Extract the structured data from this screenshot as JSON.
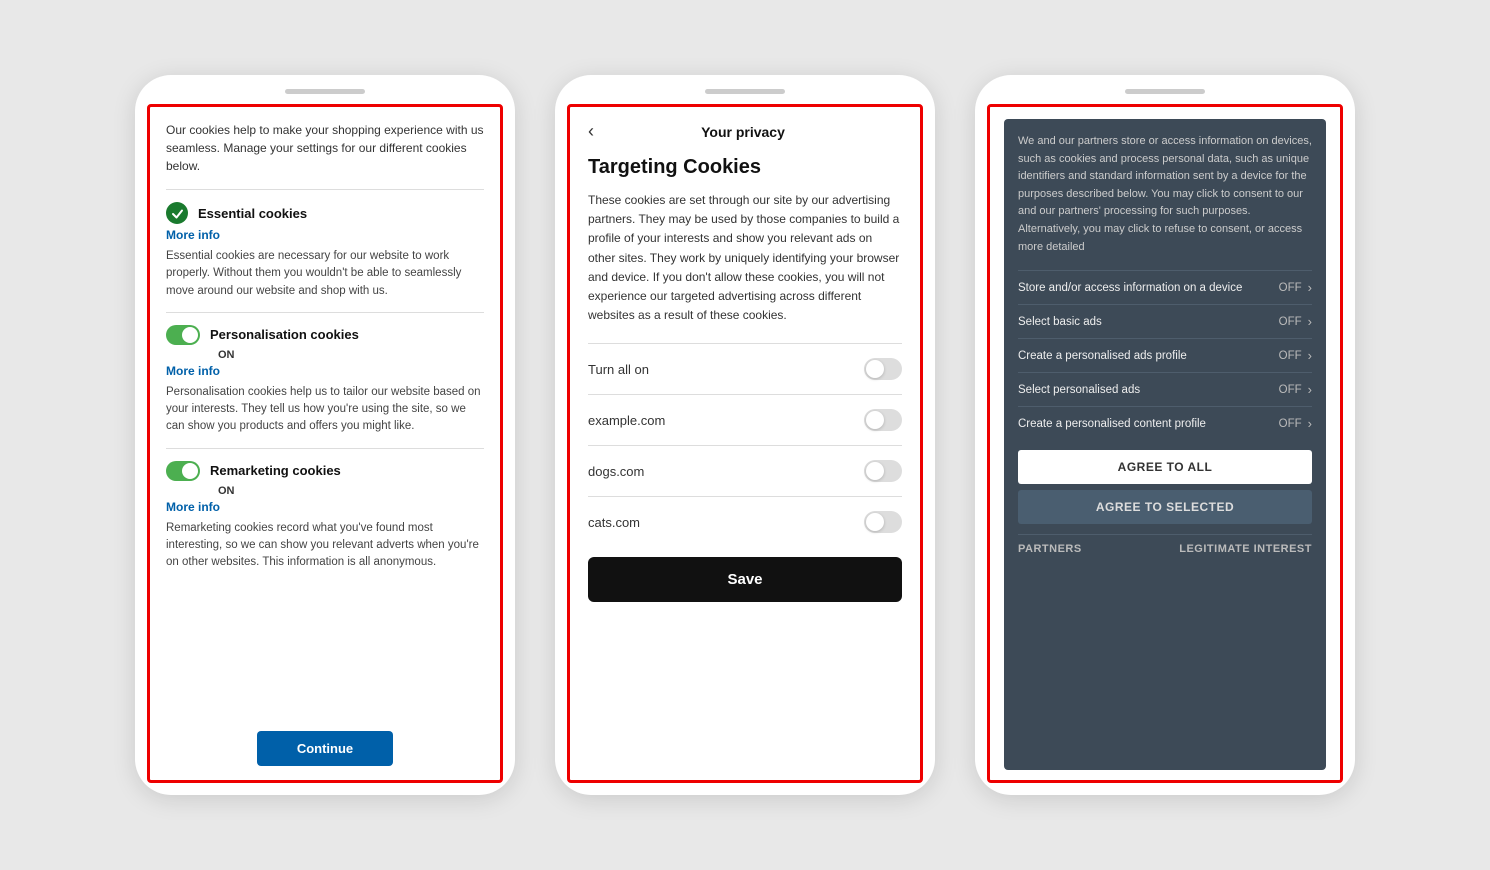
{
  "phone1": {
    "intro": "Our cookies help to make your shopping experience with us seamless. Manage your settings for our different cookies below.",
    "essential": {
      "title": "Essential cookies",
      "more_info": "More info",
      "desc": "Essential cookies are necessary for our website to work properly. Without them you wouldn't be able to seamlessly move around our website and shop with us."
    },
    "personalisation": {
      "title": "Personalisation cookies",
      "on_label": "ON",
      "more_info": "More info",
      "desc": "Personalisation cookies help us to tailor our website based on your interests. They tell us how you're using the site, so we can show you products and offers you might like."
    },
    "remarketing": {
      "title": "Remarketing cookies",
      "on_label": "ON",
      "more_info": "More info",
      "desc": "Remarketing cookies record what you've found most interesting, so we can show you relevant adverts when you're on other websites. This information is all anonymous."
    },
    "button": "Continue"
  },
  "phone2": {
    "back_label": "‹",
    "title": "Your privacy",
    "targeting_title": "Targeting Cookies",
    "desc": "These cookies are set through our site by our advertising partners. They may be used by those companies to build a profile of your interests and show you relevant ads on other sites. They work by uniquely identifying your browser and device. If you don't allow these cookies, you will not experience our targeted advertising across different websites as a result of these cookies.",
    "rows": [
      {
        "label": "Turn all on"
      },
      {
        "label": "example.com"
      },
      {
        "label": "dogs.com"
      },
      {
        "label": "cats.com"
      }
    ],
    "save_button": "Save"
  },
  "phone3": {
    "intro": "We and our partners store or access information on devices, such as cookies and process personal data, such as unique identifiers and standard information sent by a device for the purposes described below. You may click to consent to our and our partners' processing for such purposes. Alternatively, you may click to refuse to consent, or access more detailed",
    "prefs": [
      {
        "label": "Store and/or access information on a device",
        "status": "OFF"
      },
      {
        "label": "Select basic ads",
        "status": "OFF"
      },
      {
        "label": "Create a personalised ads profile",
        "status": "OFF"
      },
      {
        "label": "Select personalised ads",
        "status": "OFF"
      },
      {
        "label": "Create a personalised content profile",
        "status": "OFF"
      }
    ],
    "agree_all": "AGREE TO ALL",
    "agree_selected": "AGREE TO SELECTED",
    "partners": "PARTNERS",
    "legitimate": "LEGITIMATE INTEREST"
  }
}
